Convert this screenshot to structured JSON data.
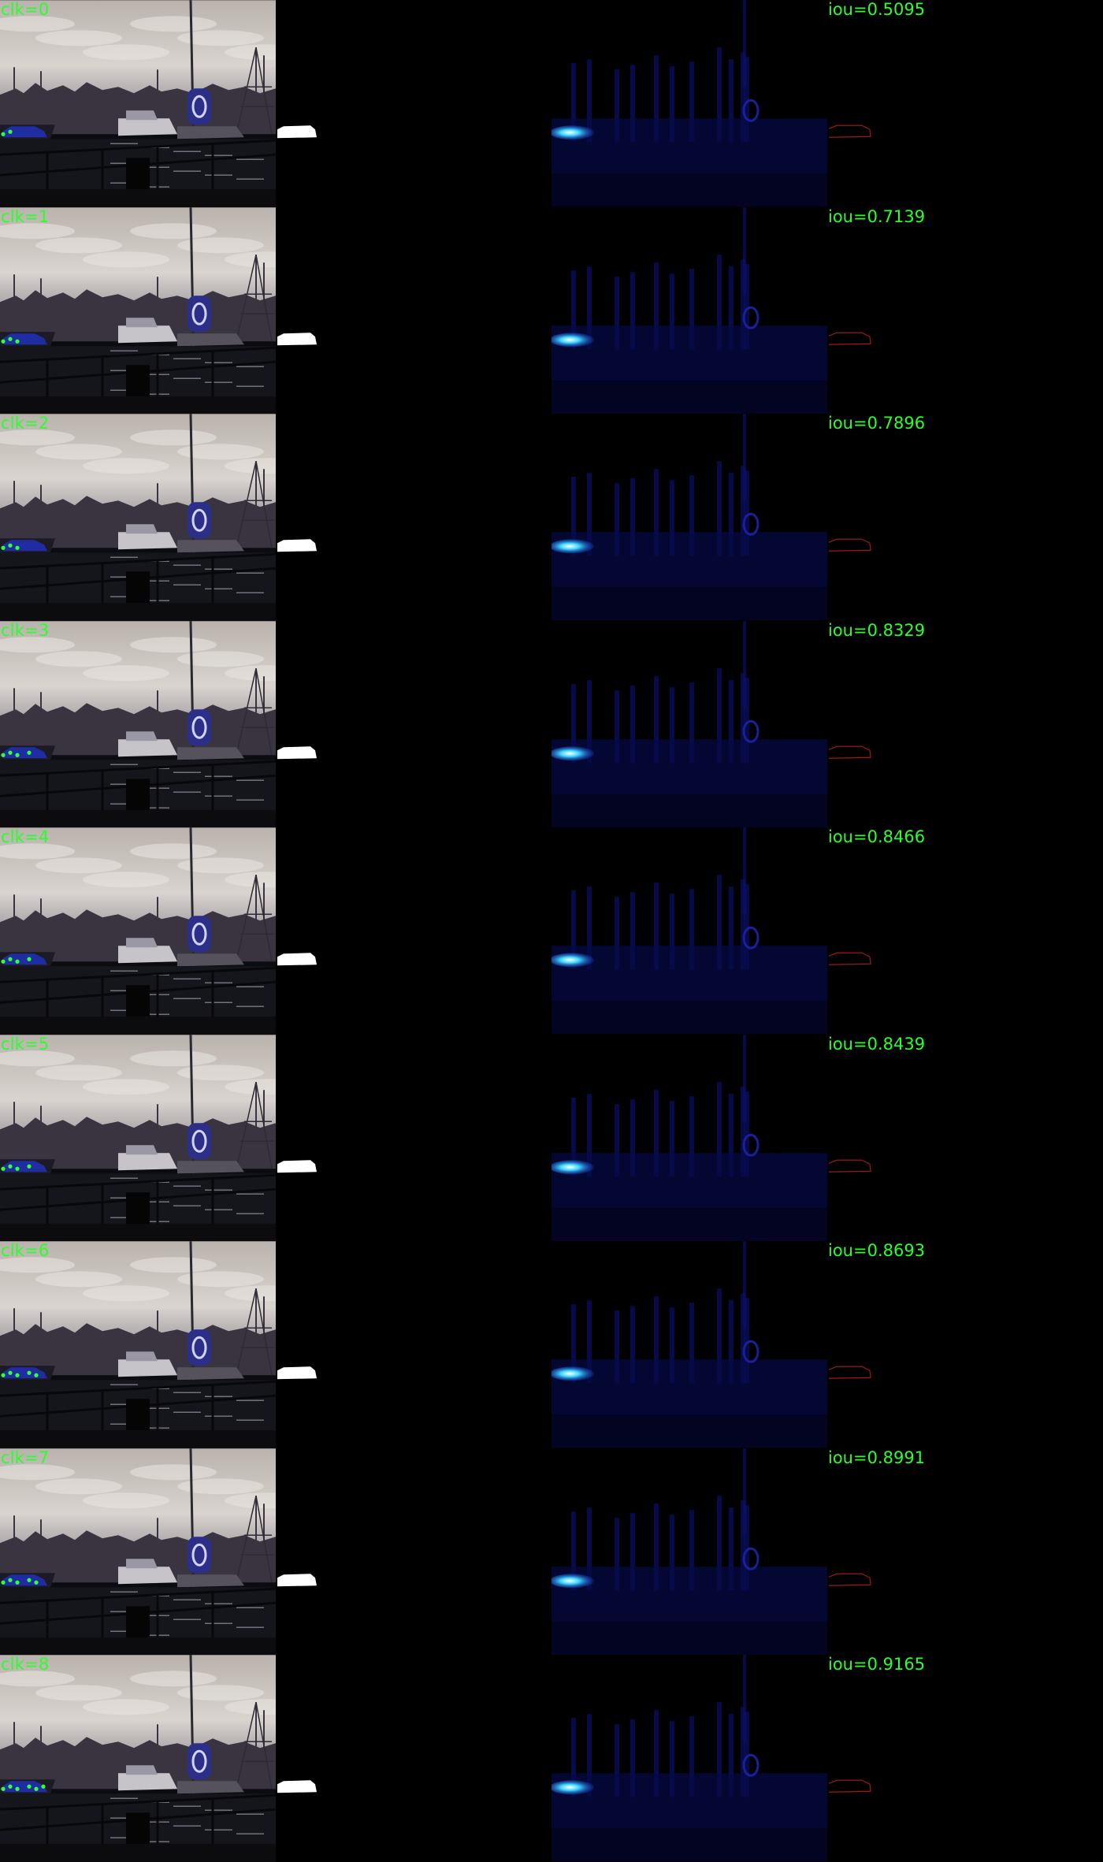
{
  "rows": [
    {
      "clk": "clk=0",
      "iou": "iou=0.5095",
      "clicks": 2
    },
    {
      "clk": "clk=1",
      "iou": "iou=0.7139",
      "clicks": 3
    },
    {
      "clk": "clk=2",
      "iou": "iou=0.7896",
      "clicks": 3
    },
    {
      "clk": "clk=3",
      "iou": "iou=0.8329",
      "clicks": 4
    },
    {
      "clk": "clk=4",
      "iou": "iou=0.8466",
      "clicks": 4
    },
    {
      "clk": "clk=5",
      "iou": "iou=0.8439",
      "clicks": 4
    },
    {
      "clk": "clk=6",
      "iou": "iou=0.8693",
      "clicks": 5
    },
    {
      "clk": "clk=7",
      "iou": "iou=0.8991",
      "clicks": 5
    },
    {
      "clk": "clk=8",
      "iou": "iou=0.9165",
      "clicks": 6
    }
  ],
  "colors": {
    "label": "#2bff2b",
    "click_positive": "#33ff33",
    "mask": "#ffffff",
    "prob_hot": "#3fd8ff",
    "prob_cold": "#06085a",
    "error": "#ff2a2a",
    "error_outline": "#2040ff"
  }
}
